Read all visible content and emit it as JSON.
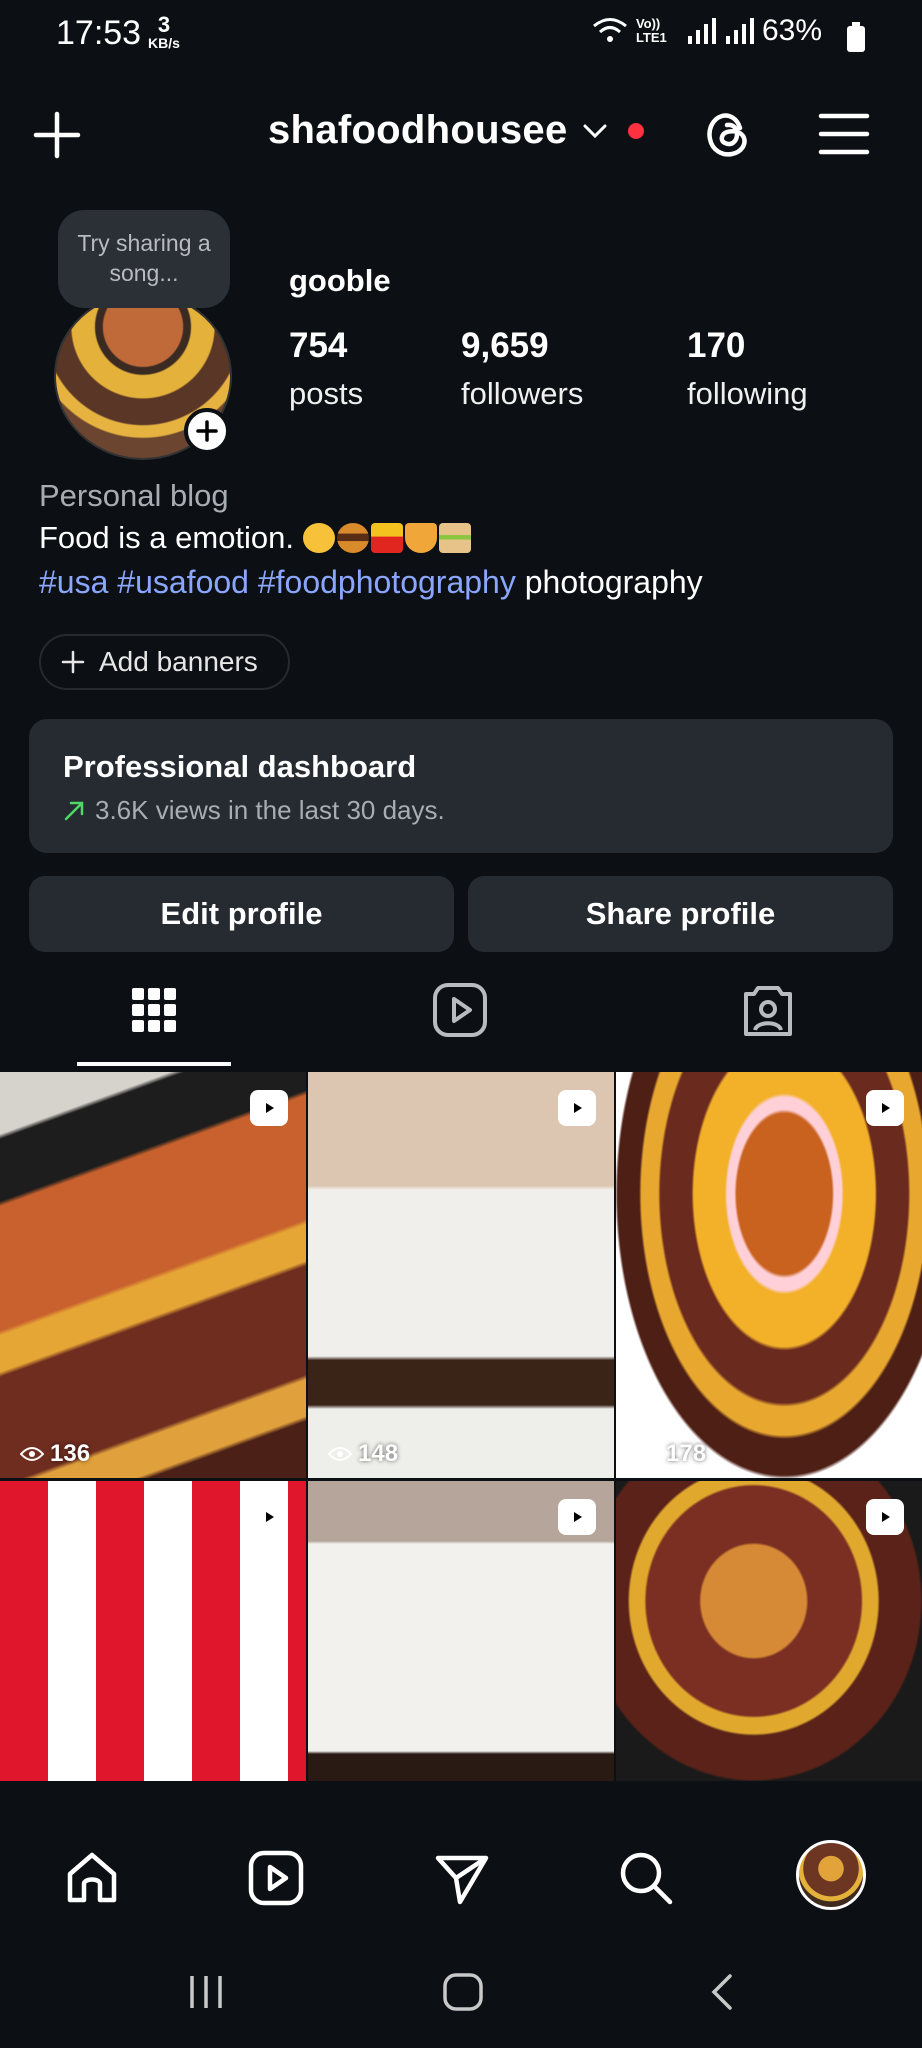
{
  "status_bar": {
    "time": "17:53",
    "speed_value": "3",
    "speed_unit": "KB/s",
    "network": "Vo)) LTE1",
    "battery": "63%"
  },
  "header": {
    "username": "shafoodhousee",
    "notification_dot_color": "#ff3040"
  },
  "profile": {
    "note_bubble": "Try sharing a song...",
    "display_name": "gooble",
    "stats": [
      {
        "value": "754",
        "label": "posts"
      },
      {
        "value": "9,659",
        "label": "followers"
      },
      {
        "value": "170",
        "label": "following"
      }
    ],
    "category": "Personal blog",
    "bio": "Food is a emotion.",
    "hashtags": [
      "#usa",
      "#usafood",
      "#foodphotography"
    ],
    "bio_tail": "photography",
    "add_banners": "Add banners"
  },
  "dashboard": {
    "title": "Professional dashboard",
    "subtitle": "3.6K views in the last 30 days."
  },
  "buttons": {
    "edit": "Edit profile",
    "share": "Share profile"
  },
  "tabs": [
    "grid-icon",
    "reels-icon",
    "tagged-icon"
  ],
  "grid": [
    {
      "views": "136",
      "type": "reel"
    },
    {
      "views": "148",
      "type": "reel"
    },
    {
      "views": "178",
      "type": "reel"
    },
    {
      "views": "",
      "type": "reel"
    },
    {
      "views": "",
      "type": "reel"
    },
    {
      "views": "",
      "type": "reel"
    }
  ],
  "bottom_nav": [
    "home-icon",
    "reels-icon",
    "direct-icon",
    "search-icon",
    "profile-avatar"
  ],
  "colors": {
    "background": "#0c1014",
    "card": "#262b31",
    "hashtag": "#8aa6ff",
    "trend_arrow": "#4cd964"
  }
}
